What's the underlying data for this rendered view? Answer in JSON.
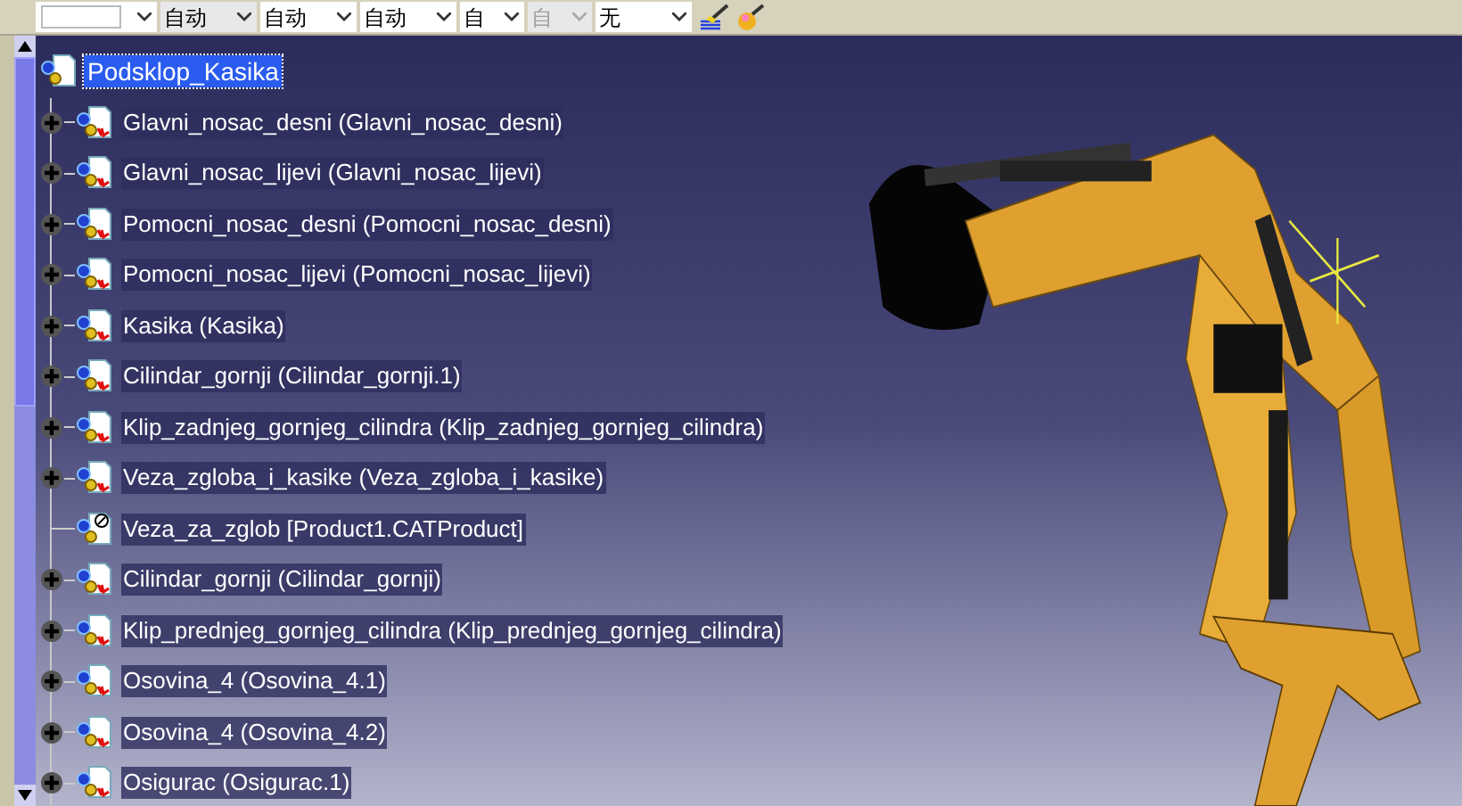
{
  "toolbar": {
    "dropdowns": [
      {
        "disabled": false,
        "kind": "blank"
      },
      {
        "value": "自动",
        "disabled": false,
        "kind": "grey"
      },
      {
        "value": "自动",
        "disabled": false,
        "kind": "white"
      },
      {
        "value": "自动",
        "disabled": false,
        "kind": "white"
      },
      {
        "value": "自",
        "disabled": false,
        "kind": "narrow"
      },
      {
        "value": "自",
        "disabled": true,
        "kind": "narrow"
      },
      {
        "value": "无",
        "disabled": false,
        "kind": "wide"
      }
    ]
  },
  "tree": {
    "root": {
      "label": "Podsklop_Kasika",
      "selected": true
    },
    "children": [
      {
        "label": "Glavni_nosac_desni (Glavni_nosac_desni)",
        "kind": "part",
        "selected": false
      },
      {
        "label": "Glavni_nosac_lijevi (Glavni_nosac_lijevi)",
        "kind": "part",
        "selected": false
      },
      {
        "label": "Pomocni_nosac_desni (Pomocni_nosac_desni)",
        "kind": "part",
        "selected": false
      },
      {
        "label": "Pomocni_nosac_lijevi (Pomocni_nosac_lijevi)",
        "kind": "part",
        "selected": false
      },
      {
        "label": "Kasika (Kasika)",
        "kind": "part",
        "selected": false
      },
      {
        "label": "Cilindar_gornji (Cilindar_gornji.1)",
        "kind": "part",
        "selected": false
      },
      {
        "label": "Klip_zadnjeg_gornjeg_cilindra (Klip_zadnjeg_gornjeg_cilindra)",
        "kind": "part",
        "selected": false
      },
      {
        "label": "Veza_zgloba_i_kasike (Veza_zgloba_i_kasike)",
        "kind": "part",
        "selected": false
      },
      {
        "label": "Veza_za_zglob [Product1.CATProduct]",
        "kind": "unloaded",
        "selected": false
      },
      {
        "label": "Cilindar_gornji (Cilindar_gornji)",
        "kind": "part",
        "selected": false
      },
      {
        "label": "Klip_prednjeg_gornjeg_cilindra (Klip_prednjeg_gornjeg_cilindra)",
        "kind": "part",
        "selected": false
      },
      {
        "label": "Osovina_4 (Osovina_4.1)",
        "kind": "part",
        "selected": false
      },
      {
        "label": "Osovina_4 (Osovina_4.2)",
        "kind": "part",
        "selected": false
      },
      {
        "label": "Osigurac (Osigurac.1)",
        "kind": "part",
        "selected": false
      }
    ]
  }
}
